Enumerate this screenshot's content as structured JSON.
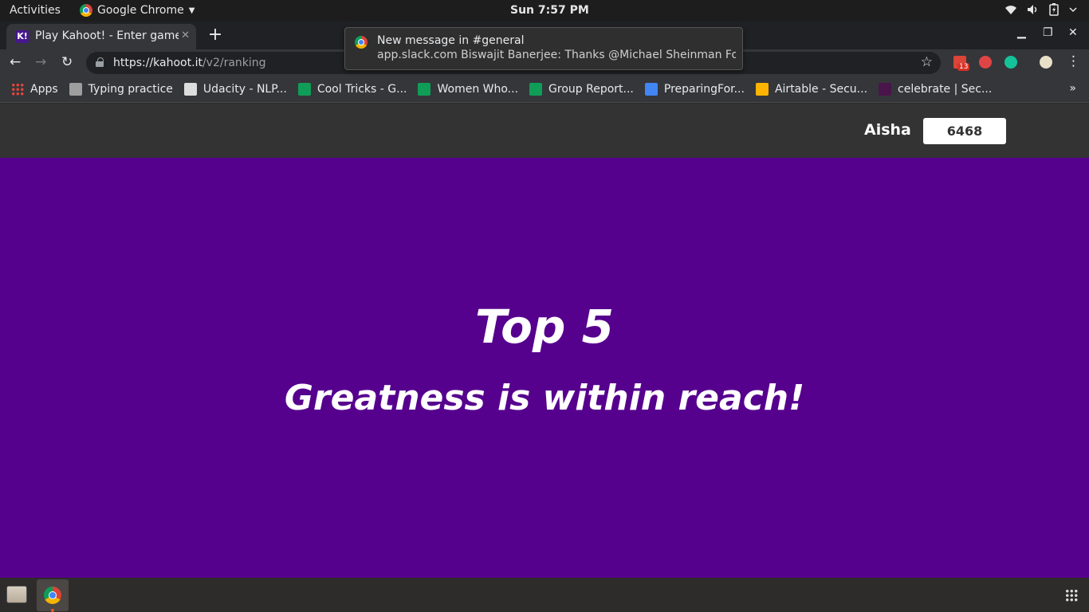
{
  "topbar": {
    "activities": "Activities",
    "app_name": "Google Chrome",
    "clock": "Sun  7:57 PM",
    "icons": [
      "wifi-icon",
      "volume-icon",
      "battery-icon",
      "power-menu-icon"
    ]
  },
  "browser": {
    "tab_title": "Play Kahoot! - Enter game PIN",
    "favicon": "K!",
    "url_host": "https://kahoot.it",
    "url_path": "/v2/ranking",
    "extension_badge": "13"
  },
  "notification": {
    "title": "New message in #general",
    "body": "app.slack.com  Biswajit Banerjee: Thanks @Michael Sheinman For..."
  },
  "bookmarks": [
    {
      "label": "Apps",
      "color": "#e8453c"
    },
    {
      "label": "Typing practice",
      "color": "#9e9e9e"
    },
    {
      "label": "Udacity - NLP...",
      "color": "#dddddd"
    },
    {
      "label": "Cool Tricks - G...",
      "color": "#0f9d58"
    },
    {
      "label": "Women Who...",
      "color": "#0f9d58"
    },
    {
      "label": "Group Report...",
      "color": "#0f9d58"
    },
    {
      "label": "PreparingFor...",
      "color": "#4285f4"
    },
    {
      "label": "Airtable - Secu...",
      "color": "#fcb400"
    },
    {
      "label": "celebrate | Sec...",
      "color": "#4a154b"
    }
  ],
  "kahoot": {
    "player_name": "Aisha",
    "score": "6468",
    "title": "Top 5",
    "subtitle": "Greatness is within reach!",
    "colors": {
      "background": "#56008e",
      "header": "#333333"
    }
  }
}
